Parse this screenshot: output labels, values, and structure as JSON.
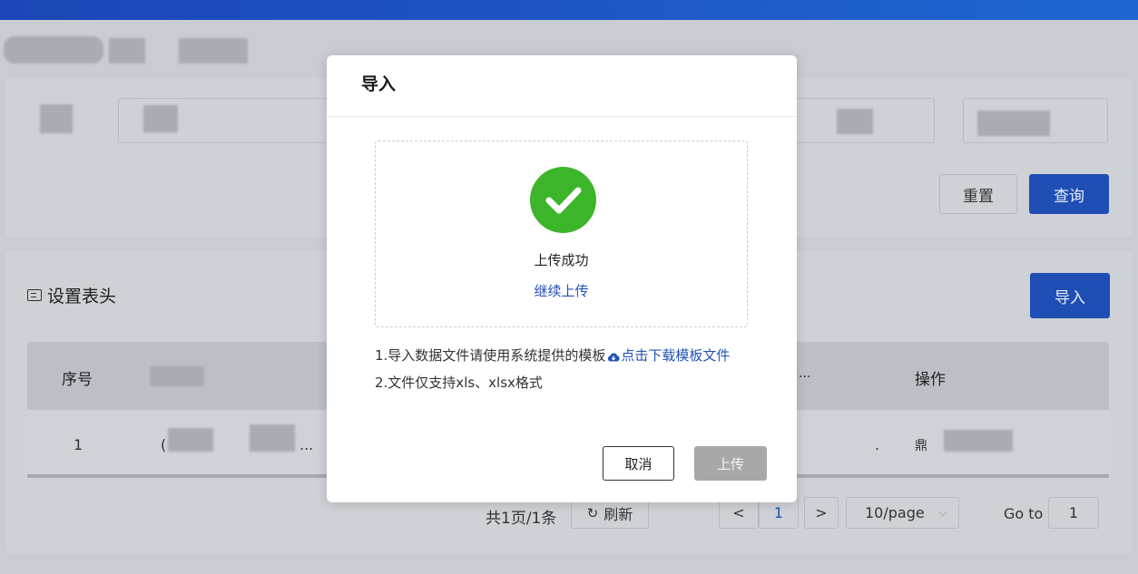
{
  "background": {
    "reset_label": "重置",
    "query_label": "查询",
    "section_title": "设置表头",
    "import_label": "导入",
    "table": {
      "headers": [
        "序号",
        "操作"
      ],
      "row": {
        "index": "1",
        "ellipsis": "...",
        "partial": "(",
        "partial2": ".",
        "partial3": "鼎"
      }
    },
    "header_ellipsis": "...",
    "pager": {
      "summary": "共1页/1条",
      "refresh_label": "刷新",
      "prev": "<",
      "current_page": "1",
      "next": ">",
      "page_size": "10/page",
      "goto_label": "Go to",
      "goto_value": "1"
    }
  },
  "modal": {
    "title": "导入",
    "upload_status": "上传成功",
    "continue_link": "继续上传",
    "tip1_text": "1.导入数据文件请使用系统提供的模板",
    "tip1_link": "点击下载模板文件",
    "tip2_text": "2.文件仅支持xls、xlsx格式",
    "cancel_label": "取消",
    "upload_label": "上传"
  },
  "colors": {
    "primary": "#1f4fb4",
    "success": "#3db52a",
    "link": "#2252b6",
    "disabled_button": "#a8a8a8"
  },
  "icons": {
    "success": "check-circle-icon",
    "cloud": "cloud-download-icon",
    "refresh": "refresh-icon",
    "section": "table-header-icon"
  }
}
